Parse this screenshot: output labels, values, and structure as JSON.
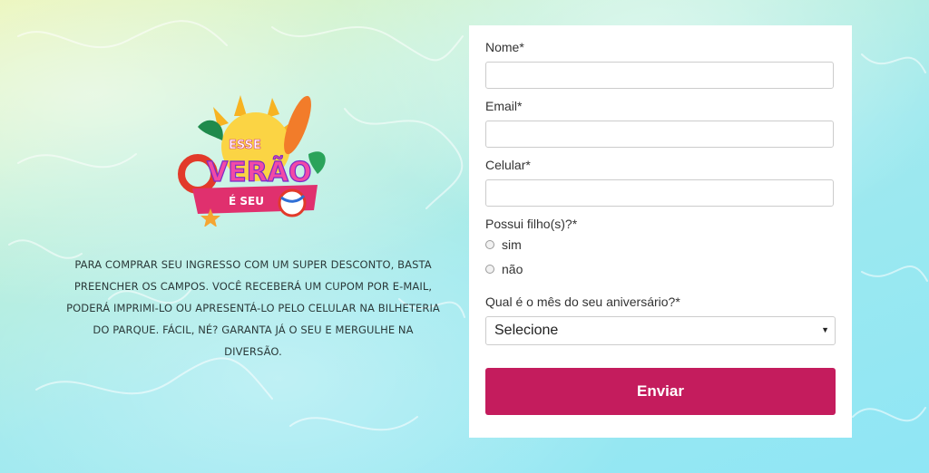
{
  "colors": {
    "accent": "#c41c5d",
    "card_bg": "#ffffff",
    "input_border": "#cccccc"
  },
  "logo": {
    "line1": "ESSE",
    "line2": "VERÃO",
    "line3": "É SEU"
  },
  "intro_text": "Para comprar seu ingresso com um super desconto, basta preencher os campos. Você receberá um cupom por e-mail, poderá imprimi-lo ou apresentá-lo pelo celular na bilheteria do parque. Fácil, né? Garanta já o seu e mergulhe na diversão.",
  "form": {
    "name_label": "Nome*",
    "name_value": "",
    "email_label": "Email*",
    "email_value": "",
    "phone_label": "Celular*",
    "phone_value": "",
    "children_label": "Possui filho(s)?*",
    "children_options": [
      "sim",
      "não"
    ],
    "birthday_label": "Qual é o mês do seu aniversário?*",
    "birthday_selected": "Selecione",
    "submit_label": "Enviar"
  }
}
